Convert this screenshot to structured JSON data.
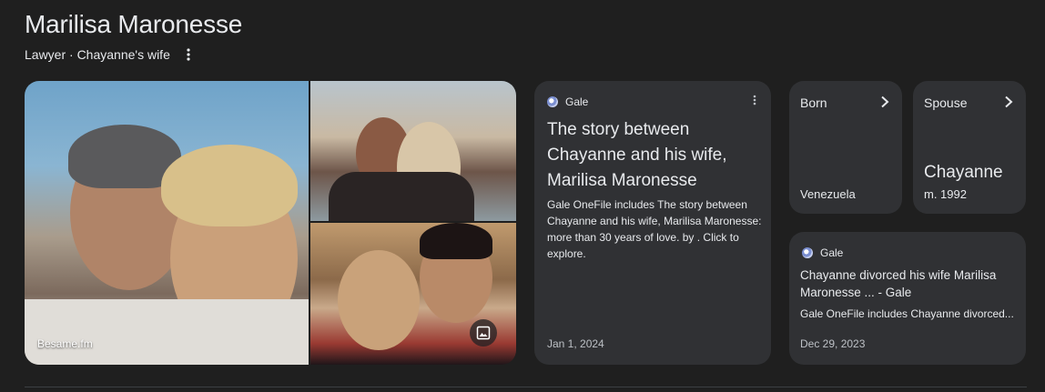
{
  "header": {
    "title": "Marilisa Maronesse",
    "subtitle": "Lawyer · Chayanne's wife"
  },
  "images": {
    "credit": "Besame.fm"
  },
  "main_card": {
    "source": "Gale",
    "title": "The story between Chayanne and his wife, Marilisa Maronesse",
    "description": "Gale OneFile includes The story between Chayanne and his wife, Marilisa Maronesse: more than 30 years of love. by . Click to explore.",
    "date": "Jan 1, 2024"
  },
  "born_card": {
    "label": "Born",
    "value": "Venezuela"
  },
  "spouse_card": {
    "label": "Spouse",
    "value": "Chayanne",
    "sub": "m. 1992"
  },
  "small_card": {
    "source": "Gale",
    "title": "Chayanne divorced his wife Marilisa Maronesse ... - Gale",
    "description": "Gale OneFile includes Chayanne divorced...",
    "date": "Dec 29, 2023"
  },
  "colors": {
    "background": "#1f1f1f",
    "card": "#303134",
    "text": "#e8eaed",
    "muted": "#bdc1c6"
  }
}
